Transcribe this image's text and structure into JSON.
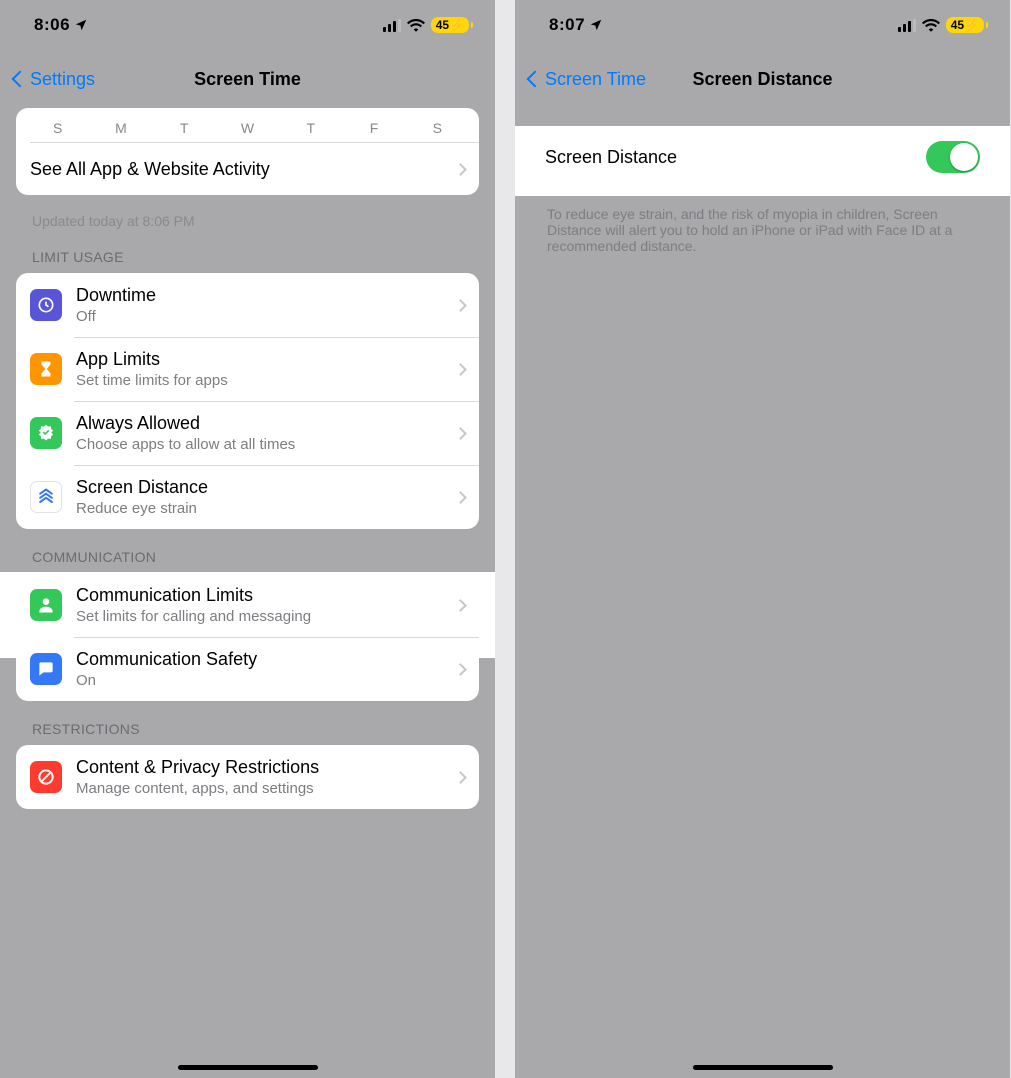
{
  "left": {
    "status": {
      "time": "8:06",
      "battery": "45"
    },
    "nav": {
      "back": "Settings",
      "title": "Screen Time"
    },
    "days": [
      "S",
      "M",
      "T",
      "W",
      "T",
      "F",
      "S"
    ],
    "activity_row": "See All App & Website Activity",
    "updated": "Updated today at 8:06 PM",
    "groups": {
      "limit_usage": {
        "header": "LIMIT USAGE",
        "items": [
          {
            "title": "Downtime",
            "sub": "Off"
          },
          {
            "title": "App Limits",
            "sub": "Set time limits for apps"
          },
          {
            "title": "Always Allowed",
            "sub": "Choose apps to allow at all times"
          },
          {
            "title": "Screen Distance",
            "sub": "Reduce eye strain"
          }
        ]
      },
      "communication": {
        "header": "COMMUNICATION",
        "items": [
          {
            "title": "Communication Limits",
            "sub": "Set limits for calling and messaging"
          },
          {
            "title": "Communication Safety",
            "sub": "On"
          }
        ]
      },
      "restrictions": {
        "header": "RESTRICTIONS",
        "items": [
          {
            "title": "Content & Privacy Restrictions",
            "sub": "Manage content, apps, and settings"
          }
        ]
      }
    }
  },
  "right": {
    "status": {
      "time": "8:07",
      "battery": "45"
    },
    "nav": {
      "back": "Screen Time",
      "title": "Screen Distance"
    },
    "row": {
      "title": "Screen Distance"
    },
    "footer": "To reduce eye strain, and the risk of myopia in children, Screen Distance will alert you to hold an iPhone or iPad with Face ID at a recommended distance."
  }
}
